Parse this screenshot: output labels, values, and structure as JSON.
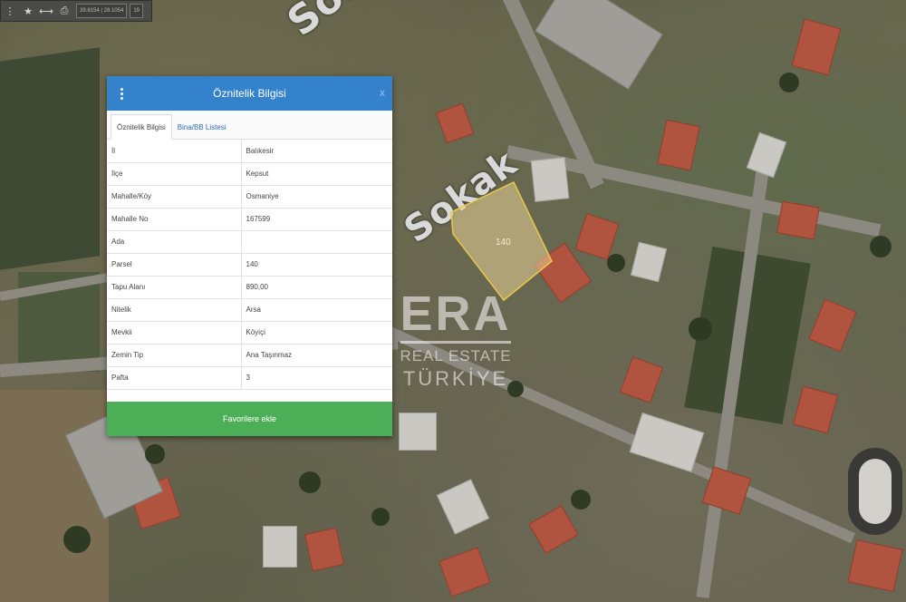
{
  "toolbar": {
    "coord_x": "39.8154",
    "coord_y": "28.1054",
    "zoom_field": "19",
    "icons": [
      "menu-dots-icon",
      "star-icon",
      "measure-icon",
      "print-icon"
    ]
  },
  "map": {
    "street_labels": [
      "Sokak",
      "Sokak"
    ],
    "parcel_number": "140",
    "watermark": {
      "brand": "ERA",
      "subtitle": "REAL ESTATE",
      "country": "TÜRKİYE"
    }
  },
  "panel": {
    "title": "Öznitelik Bilgisi",
    "close": "x",
    "tabs": [
      {
        "label": "Öznitelik Bilgisi",
        "active": true
      },
      {
        "label": "Bina/BB Listesi",
        "active": false
      }
    ],
    "rows": [
      {
        "key": "İl",
        "value": "Balıkesir"
      },
      {
        "key": "İlçe",
        "value": "Kepsut"
      },
      {
        "key": "Mahalle/Köy",
        "value": "Osmaniye"
      },
      {
        "key": "Mahalle No",
        "value": "167599"
      },
      {
        "key": "Ada",
        "value": ""
      },
      {
        "key": "Parsel",
        "value": "140"
      },
      {
        "key": "Tapu Alanı",
        "value": "890,00"
      },
      {
        "key": "Nitelik",
        "value": "Arsa"
      },
      {
        "key": "Mevkii",
        "value": "Köyiçi"
      },
      {
        "key": "Zemin Tip",
        "value": "Ana Taşınmaz"
      },
      {
        "key": "Pafta",
        "value": "3"
      }
    ],
    "favorite_button": "Favorilere ekle"
  },
  "colors": {
    "header": "#3481cc",
    "favorite": "#4cae57",
    "parcel_outline": "#e8c84a"
  }
}
